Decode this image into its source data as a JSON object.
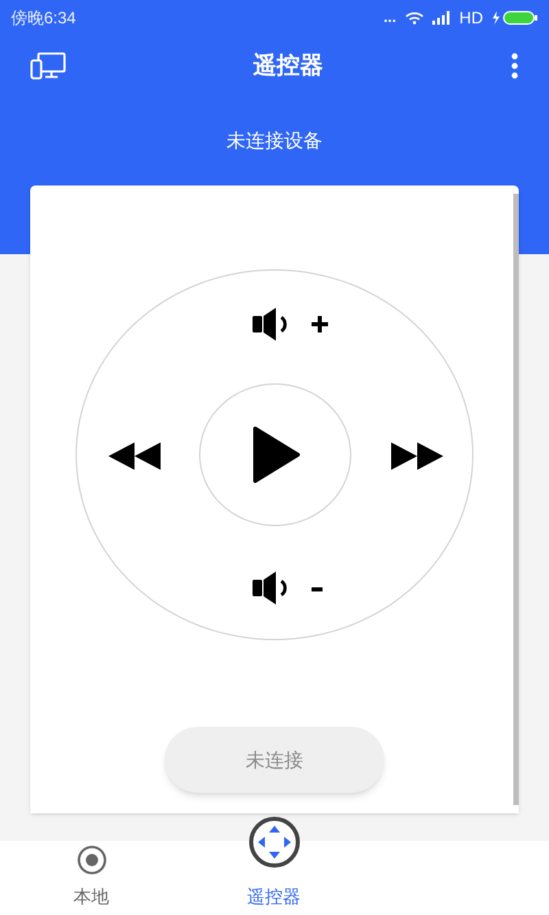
{
  "status_bar": {
    "time": "傍晚6:34",
    "more": "...",
    "network": "HD"
  },
  "header": {
    "title": "遥控器",
    "subtitle": "未连接设备"
  },
  "connect_button": {
    "label": "未连接",
    "disabled": true
  },
  "bottom_nav": [
    {
      "label": "本地",
      "selected": false,
      "kind": "local"
    },
    {
      "label": "遥控器",
      "selected": true,
      "kind": "remote"
    }
  ]
}
